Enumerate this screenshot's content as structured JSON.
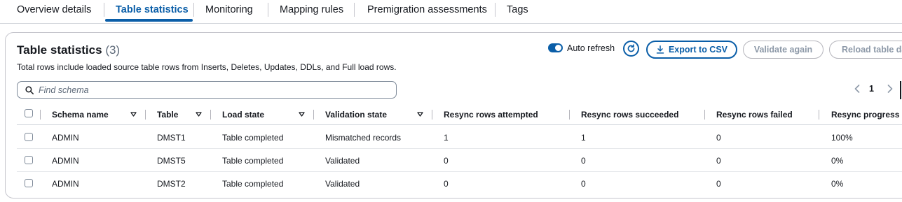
{
  "tabs": [
    {
      "label": "Overview details"
    },
    {
      "label": "Table statistics"
    },
    {
      "label": "Monitoring"
    },
    {
      "label": "Mapping rules"
    },
    {
      "label": "Premigration assessments"
    },
    {
      "label": "Tags"
    }
  ],
  "active_tab": "Table statistics",
  "header": {
    "title": "Table statistics",
    "count": "(3)",
    "description": "Total rows include loaded source table rows from Inserts, Deletes, Updates, DDLs, and Full load rows."
  },
  "actions": {
    "auto_refresh_label": "Auto refresh",
    "auto_refresh_on": true,
    "refresh_icon": "refresh-icon",
    "export_label": "Export to CSV",
    "export_icon": "download-icon",
    "validate_label": "Validate again",
    "reload_label": "Reload table data"
  },
  "search": {
    "placeholder": "Find schema",
    "value": ""
  },
  "pagination": {
    "current_page": "1"
  },
  "table": {
    "columns": [
      "Schema name",
      "Table",
      "Load state",
      "Validation state",
      "Resync rows attempted",
      "Resync rows succeeded",
      "Resync rows failed",
      "Resync progress"
    ],
    "rows": [
      [
        "ADMIN",
        "DMST1",
        "Table completed",
        "Mismatched records",
        "1",
        "1",
        "0",
        "100%"
      ],
      [
        "ADMIN",
        "DMST5",
        "Table completed",
        "Validated",
        "0",
        "0",
        "0",
        "0%"
      ],
      [
        "ADMIN",
        "DMST2",
        "Table completed",
        "Validated",
        "0",
        "0",
        "0",
        "0%"
      ]
    ]
  },
  "colors": {
    "accent": "#0a5ea8",
    "text": "#16191f",
    "disabled": "#8d99a8",
    "border": "#c6c6cd"
  }
}
